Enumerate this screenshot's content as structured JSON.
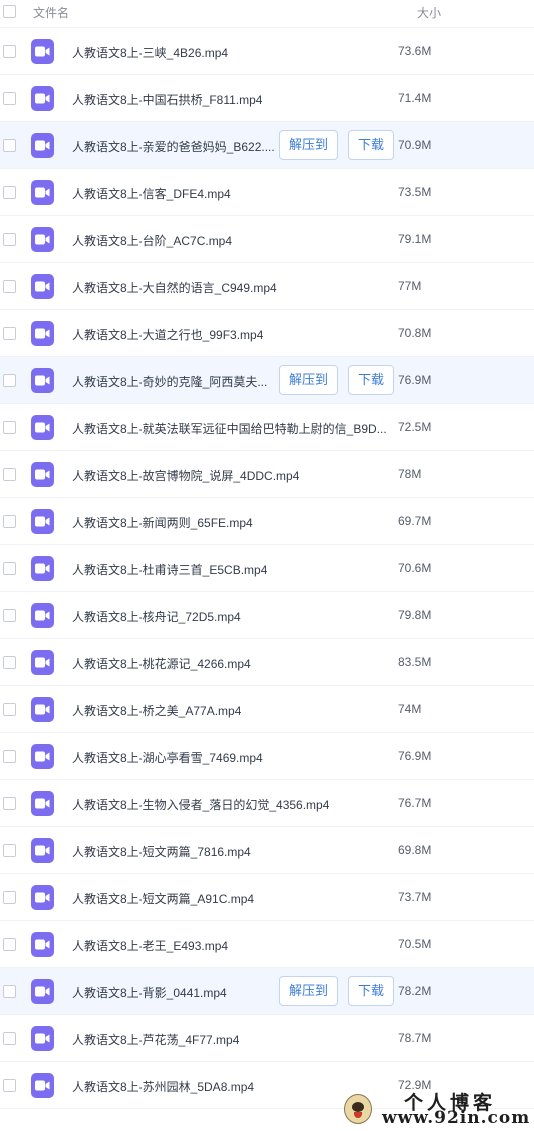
{
  "header": {
    "name_label": "文件名",
    "size_label": "大小"
  },
  "actions": {
    "extract_label": "解压到",
    "download_label": "下载"
  },
  "files": [
    {
      "name": "人教语文8上-三峡_4B26.mp4",
      "size": "73.6M",
      "highlighted": false
    },
    {
      "name": "人教语文8上-中国石拱桥_F811.mp4",
      "size": "71.4M",
      "highlighted": false
    },
    {
      "name": "人教语文8上-亲爱的爸爸妈妈_B622....",
      "size": "70.9M",
      "highlighted": true
    },
    {
      "name": "人教语文8上-信客_DFE4.mp4",
      "size": "73.5M",
      "highlighted": false
    },
    {
      "name": "人教语文8上-台阶_AC7C.mp4",
      "size": "79.1M",
      "highlighted": false
    },
    {
      "name": "人教语文8上-大自然的语言_C949.mp4",
      "size": "77M",
      "highlighted": false
    },
    {
      "name": "人教语文8上-大道之行也_99F3.mp4",
      "size": "70.8M",
      "highlighted": false
    },
    {
      "name": "人教语文8上-奇妙的克隆_阿西莫夫...",
      "size": "76.9M",
      "highlighted": true
    },
    {
      "name": "人教语文8上-就英法联军远征中国给巴特勒上尉的信_B9D...",
      "size": "72.5M",
      "highlighted": false
    },
    {
      "name": "人教语文8上-故宫博物院_说屏_4DDC.mp4",
      "size": "78M",
      "highlighted": false
    },
    {
      "name": "人教语文8上-新闻两则_65FE.mp4",
      "size": "69.7M",
      "highlighted": false
    },
    {
      "name": "人教语文8上-杜甫诗三首_E5CB.mp4",
      "size": "70.6M",
      "highlighted": false
    },
    {
      "name": "人教语文8上-核舟记_72D5.mp4",
      "size": "79.8M",
      "highlighted": false
    },
    {
      "name": "人教语文8上-桃花源记_4266.mp4",
      "size": "83.5M",
      "highlighted": false
    },
    {
      "name": "人教语文8上-桥之美_A77A.mp4",
      "size": "74M",
      "highlighted": false
    },
    {
      "name": "人教语文8上-湖心亭看雪_7469.mp4",
      "size": "76.9M",
      "highlighted": false
    },
    {
      "name": "人教语文8上-生物入侵者_落日的幻觉_4356.mp4",
      "size": "76.7M",
      "highlighted": false
    },
    {
      "name": "人教语文8上-短文两篇_7816.mp4",
      "size": "69.8M",
      "highlighted": false
    },
    {
      "name": "人教语文8上-短文两篇_A91C.mp4",
      "size": "73.7M",
      "highlighted": false
    },
    {
      "name": "人教语文8上-老王_E493.mp4",
      "size": "70.5M",
      "highlighted": false
    },
    {
      "name": "人教语文8上-背影_0441.mp4",
      "size": "78.2M",
      "highlighted": true
    },
    {
      "name": "人教语文8上-芦花荡_4F77.mp4",
      "size": "78.7M",
      "highlighted": false
    },
    {
      "name": "人教语文8上-苏州园林_5DA8.mp4",
      "size": "72.9M",
      "highlighted": false
    }
  ],
  "watermark": {
    "title": "个人博客",
    "url": "www.92in.com"
  },
  "colors": {
    "icon": "#7c6df0",
    "highlight_row": "#f2f7ff",
    "button_text": "#3d7dd8"
  },
  "icons": {
    "file": "video-file-icon"
  }
}
